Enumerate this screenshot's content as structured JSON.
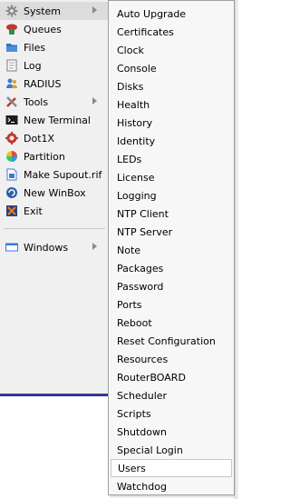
{
  "main_menu": {
    "items": [
      {
        "label": "System",
        "icon": "gear-icon",
        "has_submenu": true,
        "selected": true
      },
      {
        "label": "Queues",
        "icon": "queues-icon",
        "has_submenu": false
      },
      {
        "label": "Files",
        "icon": "folder-icon",
        "has_submenu": false
      },
      {
        "label": "Log",
        "icon": "log-icon",
        "has_submenu": false
      },
      {
        "label": "RADIUS",
        "icon": "users-icon",
        "has_submenu": false
      },
      {
        "label": "Tools",
        "icon": "tools-icon",
        "has_submenu": true
      },
      {
        "label": "New Terminal",
        "icon": "terminal-icon",
        "has_submenu": false
      },
      {
        "label": "Dot1X",
        "icon": "dot1x-icon",
        "has_submenu": false
      },
      {
        "label": "Partition",
        "icon": "partition-icon",
        "has_submenu": false
      },
      {
        "label": "Make Supout.rif",
        "icon": "document-icon",
        "has_submenu": false
      },
      {
        "label": "New WinBox",
        "icon": "winbox-icon",
        "has_submenu": false
      },
      {
        "label": "Exit",
        "icon": "exit-icon",
        "has_submenu": false
      }
    ],
    "windows": {
      "label": "Windows",
      "icon": "window-icon",
      "has_submenu": true
    }
  },
  "submenu": {
    "items": [
      "Auto Upgrade",
      "Certificates",
      "Clock",
      "Console",
      "Disks",
      "Health",
      "History",
      "Identity",
      "LEDs",
      "License",
      "Logging",
      "NTP Client",
      "NTP Server",
      "Note",
      "Packages",
      "Password",
      "Ports",
      "Reboot",
      "Reset Configuration",
      "Resources",
      "RouterBOARD",
      "Scheduler",
      "Scripts",
      "Shutdown",
      "Special Login",
      "Users",
      "Watchdog"
    ],
    "hovered": "Users"
  },
  "colors": {
    "menu_bg": "#f0f0f0",
    "submenu_bg": "#f7f7f7",
    "selected_bg": "#dcdcdc",
    "bottom_border": "#3b3b9a"
  }
}
